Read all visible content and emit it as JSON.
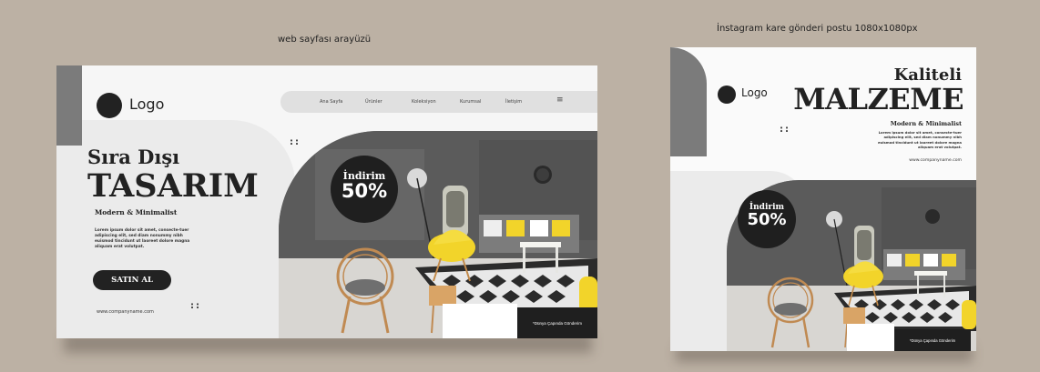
{
  "captions": {
    "web": "web sayfası arayüzü",
    "instagram": "İnstagram kare gönderi postu 1080x1080px"
  },
  "web": {
    "logo_text": "Logo",
    "nav": [
      "Ana Sayfa",
      "Ürünler",
      "Koleksiyon",
      "Kurumsal",
      "İletişim"
    ],
    "menu_icon": "hamburger-icon",
    "menu_glyph": "≡",
    "heading_small": "Sıra Dışı",
    "heading_big": "TASARIM",
    "subheading": "Modern & Minimalist",
    "body": "Lorem ipsum dolor sit amet, consecte-tuer adipiscing elit, sed diam nonummy nibh euismod tincidunt ut laoreet dolore magna aliquam erat volutpat.",
    "button": "SATIN AL",
    "url": "www.companyname.com",
    "discount_label": "İndirim",
    "discount_value": "50%",
    "badge": "*Dünya Çapında Gönderim"
  },
  "instagram": {
    "logo_text": "Logo",
    "heading_small": "Kaliteli",
    "heading_big": "MALZEME",
    "subheading": "Modern & Minimalist",
    "body": "Lorem ipsum dolor sit amet, consecte-tuer adipiscing elit, sed diam nonummy nibh euismod tincidunt ut laoreet dolore magna aliquam erat volutpat.",
    "url": "www.companyname.com",
    "discount_label": "İndirim",
    "discount_value": "50%",
    "badge": "*Dünya Çapında Gönderim"
  },
  "colors": {
    "background": "#bcb1a4",
    "dark": "#1f1f1f",
    "gray_accent": "#7b7b7b",
    "chair_yellow": "#f2d42a"
  }
}
